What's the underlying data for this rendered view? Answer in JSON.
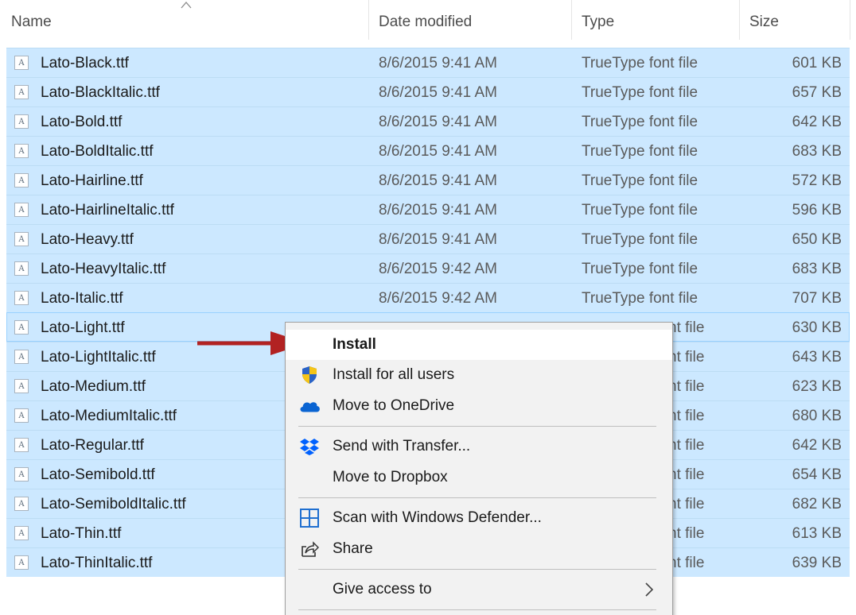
{
  "header": {
    "columns": {
      "name": "Name",
      "date": "Date modified",
      "type": "Type",
      "size": "Size"
    },
    "sort_icon": "chevron-up-icon"
  },
  "files": [
    {
      "name": "Lato-Black.ttf",
      "date": "8/6/2015 9:41 AM",
      "type": "TrueType font file",
      "size": "601 KB"
    },
    {
      "name": "Lato-BlackItalic.ttf",
      "date": "8/6/2015 9:41 AM",
      "type": "TrueType font file",
      "size": "657 KB"
    },
    {
      "name": "Lato-Bold.ttf",
      "date": "8/6/2015 9:41 AM",
      "type": "TrueType font file",
      "size": "642 KB"
    },
    {
      "name": "Lato-BoldItalic.ttf",
      "date": "8/6/2015 9:41 AM",
      "type": "TrueType font file",
      "size": "683 KB"
    },
    {
      "name": "Lato-Hairline.ttf",
      "date": "8/6/2015 9:41 AM",
      "type": "TrueType font file",
      "size": "572 KB"
    },
    {
      "name": "Lato-HairlineItalic.ttf",
      "date": "8/6/2015 9:41 AM",
      "type": "TrueType font file",
      "size": "596 KB"
    },
    {
      "name": "Lato-Heavy.ttf",
      "date": "8/6/2015 9:41 AM",
      "type": "TrueType font file",
      "size": "650 KB"
    },
    {
      "name": "Lato-HeavyItalic.ttf",
      "date": "8/6/2015 9:42 AM",
      "type": "TrueType font file",
      "size": "683 KB"
    },
    {
      "name": "Lato-Italic.ttf",
      "date": "8/6/2015 9:42 AM",
      "type": "TrueType font file",
      "size": "707 KB"
    },
    {
      "name": "Lato-Light.ttf",
      "date": "",
      "type": "nt file",
      "size": "630 KB"
    },
    {
      "name": "Lato-LightItalic.ttf",
      "date": "",
      "type": "nt file",
      "size": "643 KB"
    },
    {
      "name": "Lato-Medium.ttf",
      "date": "",
      "type": "nt file",
      "size": "623 KB"
    },
    {
      "name": "Lato-MediumItalic.ttf",
      "date": "",
      "type": "nt file",
      "size": "680 KB"
    },
    {
      "name": "Lato-Regular.ttf",
      "date": "",
      "type": "nt file",
      "size": "642 KB"
    },
    {
      "name": "Lato-Semibold.ttf",
      "date": "",
      "type": "nt file",
      "size": "654 KB"
    },
    {
      "name": "Lato-SemiboldItalic.ttf",
      "date": "",
      "type": "nt file",
      "size": "682 KB"
    },
    {
      "name": "Lato-Thin.ttf",
      "date": "",
      "type": "nt file",
      "size": "613 KB"
    },
    {
      "name": "Lato-ThinItalic.ttf",
      "date": "",
      "type": "nt file",
      "size": "639 KB"
    }
  ],
  "file_icon": "font-file-icon",
  "file_icon_glyph": "A",
  "context_menu": {
    "items": [
      {
        "label": "Install",
        "icon": "",
        "bold": true
      },
      {
        "label": "Install for all users",
        "icon": "uac-shield-icon"
      },
      {
        "label": "Move to OneDrive",
        "icon": "onedrive-cloud-icon"
      },
      {
        "label": "Send with Transfer...",
        "icon": "dropbox-icon"
      },
      {
        "label": "Move to Dropbox",
        "icon": ""
      },
      {
        "label": "Scan with Windows Defender...",
        "icon": "windows-defender-icon"
      },
      {
        "label": "Share",
        "icon": "share-icon"
      },
      {
        "label": "Give access to",
        "icon": "",
        "submenu": true
      }
    ]
  },
  "colors": {
    "selection": "#cce8ff",
    "arrow": "#b22222",
    "onedrive": "#0a64d2",
    "dropbox": "#0061fe",
    "shield_blue": "#2a63c7",
    "shield_yellow": "#f5c518"
  }
}
